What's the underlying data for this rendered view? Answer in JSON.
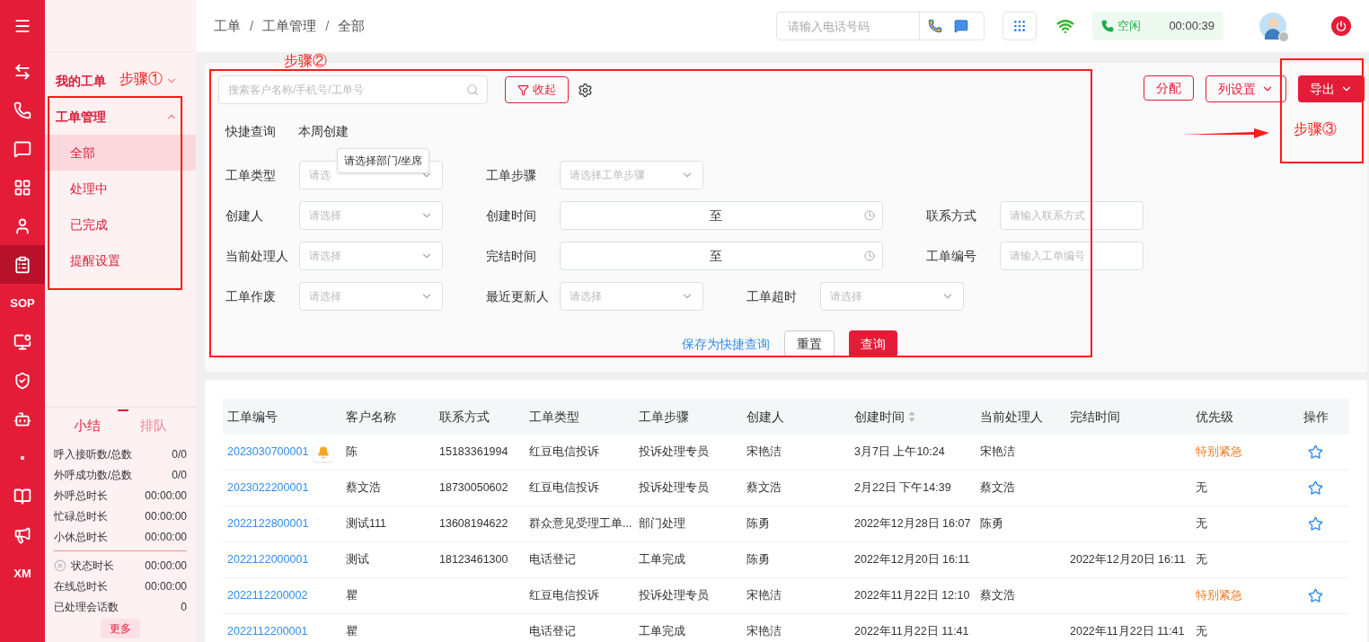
{
  "rail": {
    "items": [
      {
        "selected": false
      },
      {
        "selected": false
      },
      {
        "selected": false
      },
      {
        "selected": false
      },
      {
        "selected": false
      },
      {
        "selected": false
      },
      {
        "selected": true
      },
      {
        "label": "SOP",
        "selected": false
      },
      {
        "selected": false
      },
      {
        "selected": false
      },
      {
        "selected": false
      },
      {
        "selected": false
      },
      {
        "selected": false
      },
      {
        "selected": false
      },
      {
        "label": "XM",
        "selected": false
      }
    ]
  },
  "sidebar": {
    "groups": [
      {
        "label": "我的工单",
        "expanded": false
      },
      {
        "label": "工单管理",
        "expanded": true,
        "children": [
          {
            "label": "全部",
            "selected": true
          },
          {
            "label": "处理中",
            "selected": false
          },
          {
            "label": "已完成",
            "selected": false
          },
          {
            "label": "提醒设置",
            "selected": false
          }
        ]
      }
    ],
    "summary_tabs": [
      {
        "label": "小结",
        "selected": true
      },
      {
        "label": "排队",
        "selected": false
      }
    ],
    "stats": [
      {
        "label": "呼入接听数/总数",
        "value": "0/0"
      },
      {
        "label": "外呼成功数/总数",
        "value": "0/0"
      },
      {
        "label": "外呼总时长",
        "value": "00:00:00"
      },
      {
        "label": "忙碌总时长",
        "value": "00:00:00"
      },
      {
        "label": "小休总时长",
        "value": "00:00:00"
      }
    ],
    "stats_2": [
      {
        "label": "状态时长",
        "value": "00:00:00",
        "kind": "status"
      },
      {
        "label": "在线总时长",
        "value": "00:00:00",
        "kind": "plain"
      },
      {
        "label": "已处理会话数",
        "value": "0",
        "kind": "plain"
      }
    ],
    "more": "更多"
  },
  "breadcrumb": {
    "items": [
      "工单",
      "工单管理",
      "全部"
    ],
    "separators": [
      "/",
      "/"
    ]
  },
  "topbar": {
    "phone_placeholder": "请输入电话号码",
    "status": "空闲",
    "timer": "00:00:39"
  },
  "filter": {
    "search_placeholder": "搜索客户名称/手机号/工单号",
    "collapse": "收起",
    "quick_label": "快捷查询",
    "quick_items": [
      "本周创建"
    ],
    "rows": [
      [
        {
          "label": "工单类型",
          "kind": "select",
          "placeholder": "请选"
        },
        {
          "label": "工单步骤",
          "kind": "select",
          "placeholder": "请选择工单步骤"
        }
      ],
      [
        {
          "label": "创建人",
          "kind": "select",
          "placeholder": "请选择"
        },
        {
          "label": "创建时间",
          "kind": "range",
          "separator": "至"
        },
        {
          "label": "联系方式",
          "kind": "input",
          "placeholder": "请输入联系方式"
        }
      ],
      [
        {
          "label": "当前处理人",
          "kind": "select",
          "placeholder": "请选择"
        },
        {
          "label": "完结时间",
          "kind": "range",
          "separator": "至"
        },
        {
          "label": "工单编号",
          "kind": "input",
          "placeholder": "请输入工单编号"
        }
      ],
      [
        {
          "label": "工单作废",
          "kind": "select",
          "placeholder": "请选择"
        },
        {
          "label": "最近更新人",
          "kind": "select",
          "placeholder": "请选择"
        },
        {
          "label": "工单超时",
          "kind": "select",
          "placeholder": "请选择"
        }
      ]
    ],
    "tooltip": "请选择部门/坐席",
    "save_quick": "保存为快捷查询",
    "reset": "重置",
    "query": "查询"
  },
  "actions": {
    "assign": "分配",
    "columns": "列设置",
    "export": "导出"
  },
  "annotations": [
    "步骤①",
    "步骤②",
    "步骤③"
  ],
  "table": {
    "columns": [
      {
        "label": "工单编号"
      },
      {
        "label": "客户名称"
      },
      {
        "label": "联系方式"
      },
      {
        "label": "工单类型"
      },
      {
        "label": "工单步骤"
      },
      {
        "label": "创建人"
      },
      {
        "label": "创建时间",
        "sortable": true
      },
      {
        "label": "当前处理人"
      },
      {
        "label": "完结时间"
      },
      {
        "label": "优先级"
      },
      {
        "label": "操作"
      }
    ],
    "rows": [
      {
        "cells": [
          "2023030700001",
          "陈",
          "15183361994",
          "红豆电信投诉",
          "投诉处理专员",
          "宋艳洁",
          "3月7日 上午10:24",
          "宋艳洁",
          "",
          "特别紧急"
        ],
        "reminder": true,
        "urgent": true,
        "star": true
      },
      {
        "cells": [
          "2023022200001",
          "蔡文浩",
          "18730050602",
          "红豆电信投诉",
          "投诉处理专员",
          "蔡文浩",
          "2月22日 下午14:39",
          "蔡文浩",
          "",
          "无"
        ],
        "reminder": false,
        "urgent": false,
        "star": true
      },
      {
        "cells": [
          "2022122800001",
          "测试111",
          "13608194622",
          "群众意见受理工单...",
          "部门处理",
          "陈勇",
          "2022年12月28日 16:07",
          "陈勇",
          "",
          "无"
        ],
        "reminder": false,
        "urgent": false,
        "star": true
      },
      {
        "cells": [
          "2022122000001",
          "测试",
          "18123461300",
          "电话登记",
          "工单完成",
          "陈勇",
          "2022年12月20日 16:11",
          "",
          "2022年12月20日 16:11",
          "无"
        ],
        "reminder": false,
        "urgent": false,
        "star": false
      },
      {
        "cells": [
          "2022112200002",
          "瞿",
          "",
          "红豆电信投诉",
          "投诉处理专员",
          "宋艳洁",
          "2022年11月22日 12:10",
          "蔡文浩",
          "",
          "特别紧急"
        ],
        "reminder": false,
        "urgent": true,
        "star": true
      },
      {
        "cells": [
          "2022112200001",
          "瞿",
          "",
          "电话登记",
          "工单完成",
          "宋艳洁",
          "2022年11月22日 11:41",
          "",
          "2022年11月22日 11:41",
          "无"
        ],
        "reminder": false,
        "urgent": false,
        "star": false
      }
    ]
  }
}
